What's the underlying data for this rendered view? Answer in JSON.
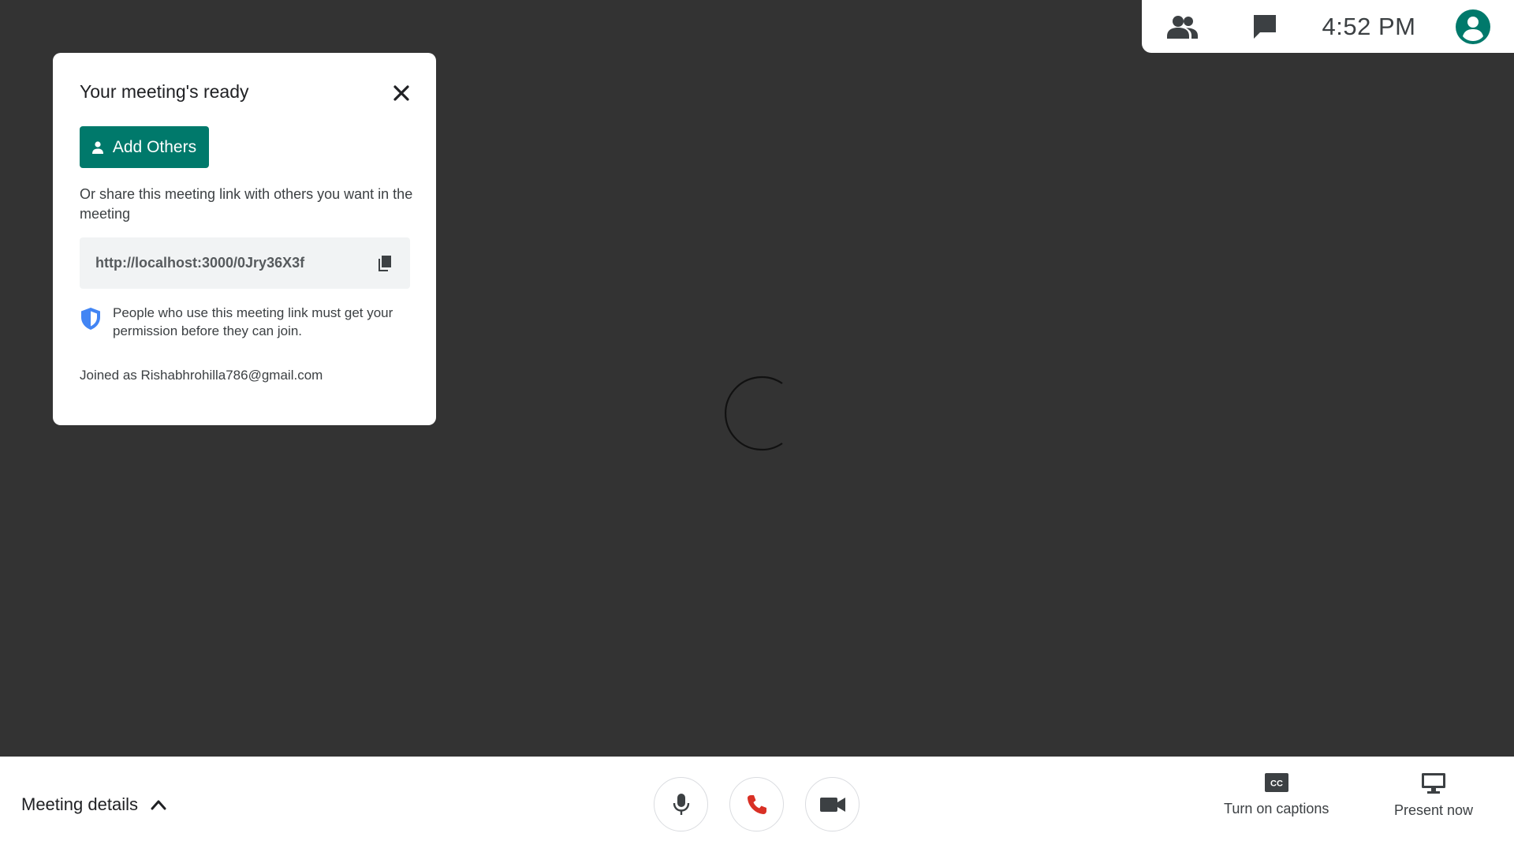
{
  "top_bar": {
    "people_icon": "people-icon",
    "chat_icon": "chat-icon",
    "time": "4:52 PM",
    "account_icon": "account-circle-icon"
  },
  "meeting_card": {
    "title": "Your meeting's ready",
    "close_icon": "close-icon",
    "add_others_label": "Add Others",
    "share_text": "Or share this meeting link with others you want in the meeting",
    "meeting_link": "http://localhost:3000/0Jry36X3f",
    "permission_text": "People who use this meeting link must get your permission before they can join.",
    "joined_as": "Joined as Rishabhrohilla786@gmail.com"
  },
  "bottom_bar": {
    "meeting_details_label": "Meeting details",
    "captions_label": "Turn on captions",
    "present_label": "Present now"
  },
  "colors": {
    "background": "#333333",
    "accent": "#00796b",
    "end_call": "#d93025",
    "shield": "#4285f4"
  }
}
